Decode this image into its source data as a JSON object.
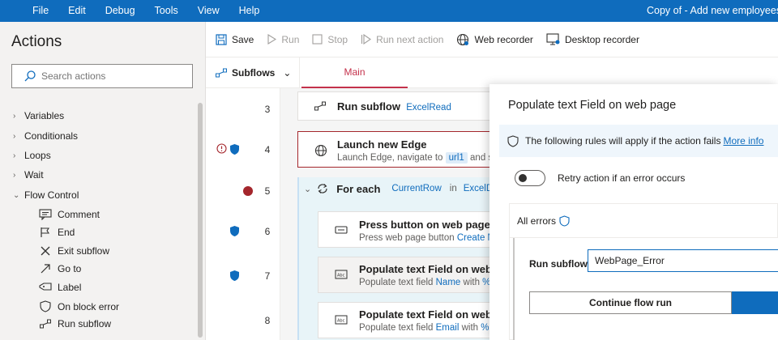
{
  "menubar": {
    "items": [
      "File",
      "Edit",
      "Debug",
      "Tools",
      "View",
      "Help"
    ],
    "title": "Copy of - Add new employees fr"
  },
  "actions_pane": {
    "heading": "Actions",
    "search_placeholder": "Search actions",
    "categories": [
      "Variables",
      "Conditionals",
      "Loops",
      "Wait",
      "Flow Control"
    ],
    "flow_control_items": [
      "Comment",
      "End",
      "Exit subflow",
      "Go to",
      "Label",
      "On block error",
      "Run subflow"
    ]
  },
  "toolbar": {
    "save": "Save",
    "run": "Run",
    "stop": "Stop",
    "run_next": "Run next action",
    "web_recorder": "Web recorder",
    "desktop_recorder": "Desktop recorder"
  },
  "tabs": {
    "subflows": "Subflows",
    "main": "Main"
  },
  "steps": {
    "s3": {
      "num": "3",
      "title": "Run subflow",
      "arg": "ExcelRead"
    },
    "s4": {
      "num": "4",
      "title": "Launch new Edge",
      "desc": "Launch Edge, navigate to",
      "token": "url1",
      "desc_tail": "and s"
    },
    "s5": {
      "num": "5",
      "title": "For each",
      "var": "CurrentRow",
      "in": "in",
      "list": "ExcelDa"
    },
    "s6": {
      "num": "6",
      "title": "Press button on web page",
      "desc": "Press web page button",
      "link": "Create Ne"
    },
    "s7": {
      "num": "7",
      "title": "Populate text Field on web p",
      "desc": "Populate text field",
      "link": "Name",
      "with": "with",
      "pct": "%"
    },
    "s8": {
      "num": "8",
      "title": "Populate text Field on web p",
      "desc": "Populate text field",
      "link": "Email",
      "with": "with",
      "pct": "%"
    }
  },
  "dialog": {
    "title": "Populate text Field on web page",
    "info_text": "The following rules will apply if the action fails",
    "info_link": "More info",
    "retry_label": "Retry action if an error occurs",
    "all_errors": "All errors",
    "run_subflow_label": "Run subflow",
    "run_subflow_value": "WebPage_Error",
    "continue_button": "Continue flow run"
  },
  "colors": {
    "accent": "#0f6cbd",
    "tab_active": "#c4314b",
    "breakpoint": "#a4262c",
    "error_border": "#a4262c"
  }
}
